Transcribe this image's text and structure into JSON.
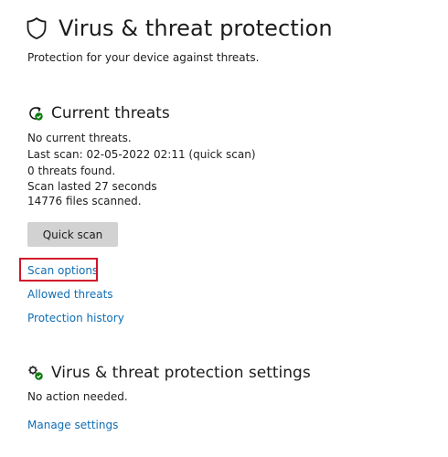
{
  "page": {
    "title": "Virus & threat protection",
    "subtitle": "Protection for your device against threats."
  },
  "current_threats": {
    "title": "Current threats",
    "status": "No current threats.",
    "last_scan": "Last scan: 02-05-2022 02:11 (quick scan)",
    "threats_found": "0 threats found.",
    "scan_duration": "Scan lasted 27 seconds",
    "files_scanned": "14776 files scanned.",
    "quick_scan_label": "Quick scan",
    "links": {
      "scan_options": "Scan options",
      "allowed_threats": "Allowed threats",
      "protection_history": "Protection history"
    }
  },
  "settings": {
    "title": "Virus & threat protection settings",
    "status": "No action needed.",
    "manage_link": "Manage settings"
  },
  "icons": {
    "page": "shield-icon",
    "current_threats": "threat-refresh-icon",
    "settings": "gears-icon"
  },
  "colors": {
    "link": "#0f6db5",
    "button_bg": "#d2d2d2",
    "highlight": "#d0142c",
    "status_ok": "#107c10"
  }
}
